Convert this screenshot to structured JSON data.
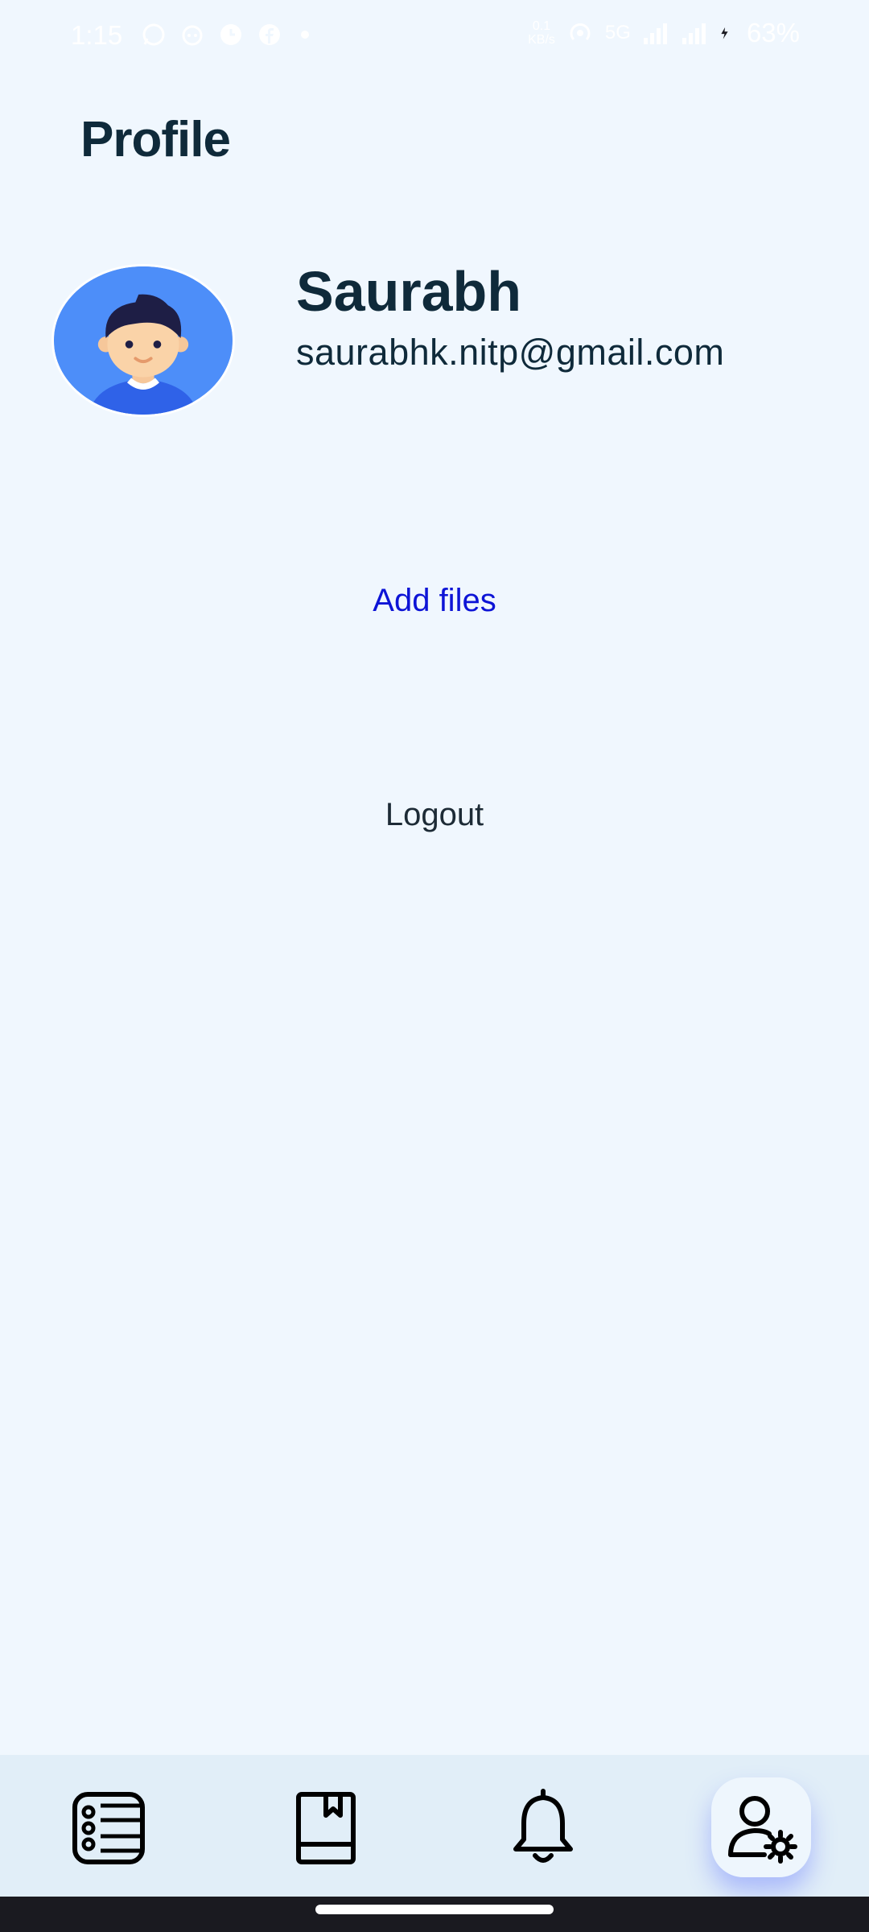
{
  "status_bar": {
    "time": "1:15",
    "net_speed_value": "0.1",
    "net_speed_unit": "KB/s",
    "network_type": "5G",
    "battery": "63%"
  },
  "page": {
    "title": "Profile"
  },
  "profile": {
    "name": "Saurabh",
    "email": "saurabhk.nitp@gmail.com"
  },
  "actions": {
    "add_files": "Add files",
    "logout": "Logout"
  },
  "colors": {
    "background": "#f0f7fe",
    "title_text": "#0f2a3a",
    "link_blue": "#0d14d6",
    "avatar_bg": "#4d8ef9",
    "nav_bg": "#e1eef8"
  },
  "bottom_nav": {
    "items": [
      {
        "icon": "list-icon",
        "active": false
      },
      {
        "icon": "bookmark-book-icon",
        "active": false
      },
      {
        "icon": "bell-icon",
        "active": false
      },
      {
        "icon": "user-settings-icon",
        "active": true
      }
    ]
  }
}
